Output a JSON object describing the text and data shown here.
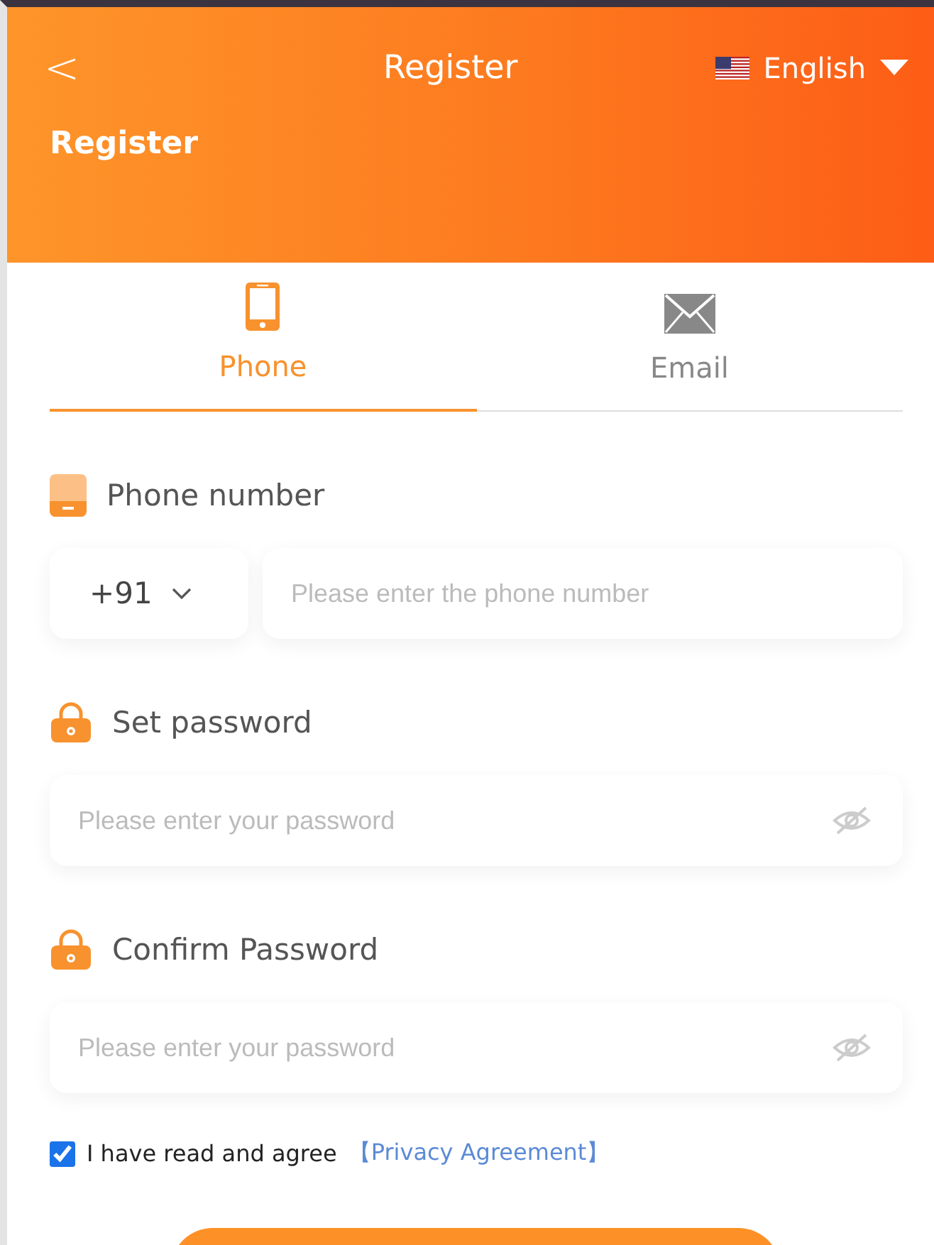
{
  "header": {
    "back": "<",
    "title": "Register",
    "language": "English",
    "heading": "Register"
  },
  "tabs": [
    {
      "label": "Phone",
      "kind": "phone",
      "selected": true
    },
    {
      "label": "Email",
      "kind": "email",
      "selected": false
    }
  ],
  "fields": [
    {
      "label": "Phone number",
      "kind": "phone",
      "country_code": "+91",
      "placeholder": "Please enter the phone number"
    },
    {
      "label": "Set password",
      "kind": "password",
      "placeholder": "Please enter your password"
    },
    {
      "label": "Confirm Password",
      "kind": "password",
      "placeholder": "Please enter your password"
    }
  ],
  "agreement": {
    "checked": true,
    "text": "I have read and agree",
    "link": "【Privacy Agreement】"
  }
}
